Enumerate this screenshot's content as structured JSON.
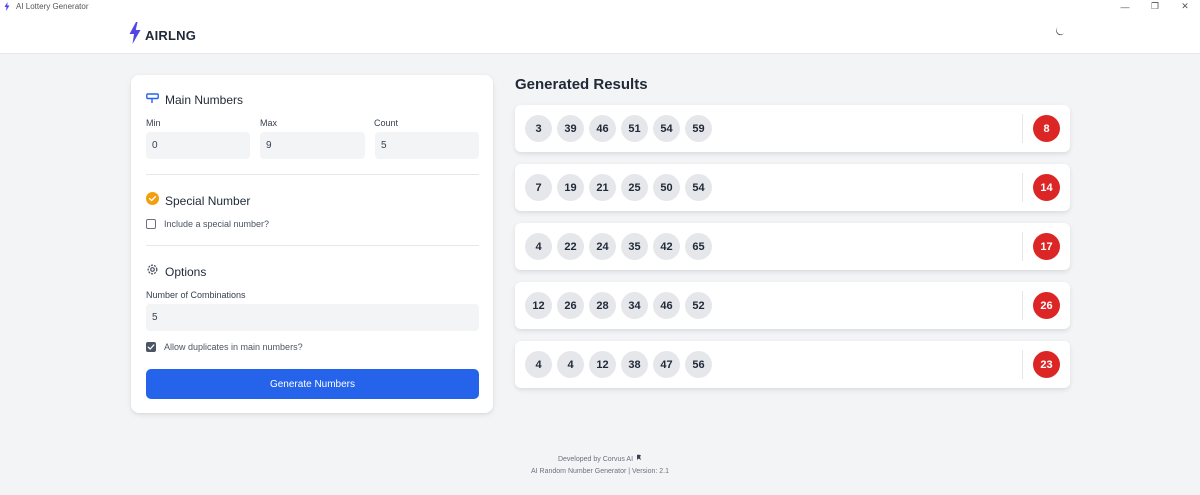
{
  "window": {
    "title": "AI Lottery Generator",
    "controls": [
      "—",
      "❐",
      "✕"
    ]
  },
  "header": {
    "brand": "AIRLNG",
    "theme_icon": "moon-icon"
  },
  "panel": {
    "main": {
      "title": "Main Numbers",
      "min_label": "Min",
      "min_value": "0",
      "max_label": "Max",
      "max_value": "9",
      "count_label": "Count",
      "count_value": "5"
    },
    "special": {
      "title": "Special Number",
      "checkbox_label": "Include a special number?",
      "checked": false
    },
    "options": {
      "title": "Options",
      "combinations_label": "Number of Combinations",
      "combinations_value": "5",
      "duplicates_label": "Allow duplicates in main numbers?",
      "duplicates_checked": true
    },
    "generate_label": "Generate Numbers"
  },
  "results": {
    "title": "Generated Results",
    "rows": [
      {
        "numbers": [
          "3",
          "39",
          "46",
          "51",
          "54",
          "59"
        ],
        "special": "8"
      },
      {
        "numbers": [
          "7",
          "19",
          "21",
          "25",
          "50",
          "54"
        ],
        "special": "14"
      },
      {
        "numbers": [
          "4",
          "22",
          "24",
          "35",
          "42",
          "65"
        ],
        "special": "17"
      },
      {
        "numbers": [
          "12",
          "26",
          "28",
          "34",
          "46",
          "52"
        ],
        "special": "26"
      },
      {
        "numbers": [
          "4",
          "4",
          "12",
          "38",
          "47",
          "56"
        ],
        "special": "23"
      }
    ]
  },
  "footer": {
    "credit": "Developed by Corvus AI",
    "version": "AI Random Number Generator | Version: 2.1"
  },
  "colors": {
    "accent": "#2563eb",
    "special_ball": "#dc2626",
    "ball": "#e5e7eb",
    "brand_icon": "#4f46e5",
    "special_icon": "#f59e0b"
  }
}
